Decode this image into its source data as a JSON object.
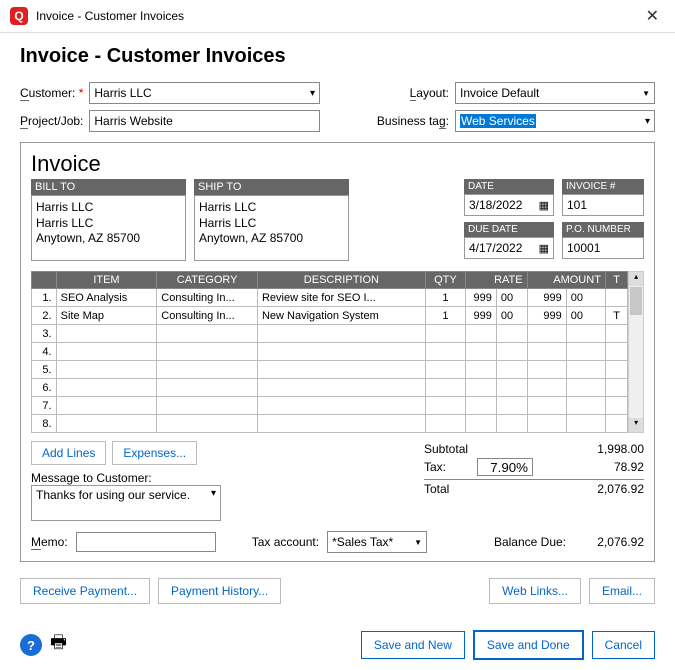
{
  "window": {
    "title": "Invoice - Customer Invoices"
  },
  "header": {
    "title": "Invoice - Customer Invoices"
  },
  "form": {
    "customer_label": "Customer:",
    "customer": "Harris LLC",
    "project_label": "Project/Job:",
    "project": "Harris Website",
    "layout_label": "Layout:",
    "layout": "Invoice Default",
    "tag_label": "Business tag:",
    "tag": "Web Services"
  },
  "invoice": {
    "title": "Invoice",
    "bill_to_label": "BILL TO",
    "bill_to": [
      "Harris LLC",
      "Harris LLC",
      "Anytown, AZ 85700"
    ],
    "ship_to_label": "SHIP TO",
    "ship_to": [
      "Harris LLC",
      "Harris LLC",
      "Anytown, AZ 85700"
    ],
    "date_label": "DATE",
    "date": "3/18/2022",
    "due_label": "DUE DATE",
    "due": "4/17/2022",
    "invno_label": "INVOICE #",
    "invno": "101",
    "po_label": "P.O. NUMBER",
    "po": "10001"
  },
  "cols": {
    "item": "ITEM",
    "cat": "CATEGORY",
    "desc": "DESCRIPTION",
    "qty": "QTY",
    "rate": "RATE",
    "amt": "AMOUNT",
    "t": "T"
  },
  "lines": [
    {
      "n": "1.",
      "item": "SEO Analysis",
      "cat": "Consulting In...",
      "desc": "Review site for SEO I...",
      "qty": "1",
      "rate": "999",
      "rc": "00",
      "amt": "999",
      "ac": "00",
      "t": ""
    },
    {
      "n": "2.",
      "item": "Site Map",
      "cat": "Consulting In...",
      "desc": "New Navigation System",
      "qty": "1",
      "rate": "999",
      "rc": "00",
      "amt": "999",
      "ac": "00",
      "t": "T"
    },
    {
      "n": "3.",
      "item": "",
      "cat": "",
      "desc": "",
      "qty": "",
      "rate": "",
      "rc": "",
      "amt": "",
      "ac": "",
      "t": ""
    },
    {
      "n": "4.",
      "item": "",
      "cat": "",
      "desc": "",
      "qty": "",
      "rate": "",
      "rc": "",
      "amt": "",
      "ac": "",
      "t": ""
    },
    {
      "n": "5.",
      "item": "",
      "cat": "",
      "desc": "",
      "qty": "",
      "rate": "",
      "rc": "",
      "amt": "",
      "ac": "",
      "t": ""
    },
    {
      "n": "6.",
      "item": "",
      "cat": "",
      "desc": "",
      "qty": "",
      "rate": "",
      "rc": "",
      "amt": "",
      "ac": "",
      "t": ""
    },
    {
      "n": "7.",
      "item": "",
      "cat": "",
      "desc": "",
      "qty": "",
      "rate": "",
      "rc": "",
      "amt": "",
      "ac": "",
      "t": ""
    },
    {
      "n": "8.",
      "item": "",
      "cat": "",
      "desc": "",
      "qty": "",
      "rate": "",
      "rc": "",
      "amt": "",
      "ac": "",
      "t": ""
    }
  ],
  "actions": {
    "add_lines": "Add Lines",
    "expenses": "Expenses..."
  },
  "message": {
    "label": "Message to Customer:",
    "value": "Thanks for using our service."
  },
  "totals": {
    "subtotal_label": "Subtotal",
    "subtotal": "1,998.00",
    "tax_label": "Tax:",
    "tax_rate": "7.90%",
    "tax_amt": "78.92",
    "total_label": "Total",
    "total": "2,076.92"
  },
  "memo": {
    "label": "Memo:",
    "value": "",
    "taxacct_label": "Tax account:",
    "taxacct": "*Sales Tax*",
    "balance_label": "Balance Due:",
    "balance": "2,076.92"
  },
  "bottom": {
    "receive": "Receive Payment...",
    "history": "Payment History...",
    "weblinks": "Web Links...",
    "email": "Email..."
  },
  "footer": {
    "save_new": "Save and New",
    "save_done": "Save and Done",
    "cancel": "Cancel"
  }
}
